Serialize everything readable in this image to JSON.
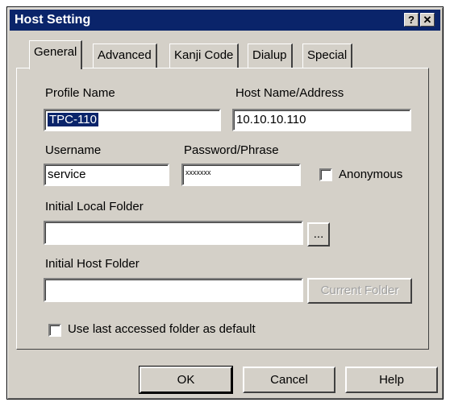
{
  "window": {
    "title": "Host Setting",
    "help_btn": "?",
    "close_btn": "✕"
  },
  "tabs": [
    {
      "label": "General",
      "active": true
    },
    {
      "label": "Advanced",
      "active": false
    },
    {
      "label": "Kanji Code",
      "active": false
    },
    {
      "label": "Dialup",
      "active": false
    },
    {
      "label": "Special",
      "active": false
    }
  ],
  "form": {
    "profile_name_label": "Profile Name",
    "profile_name_value": "TPC-110",
    "host_name_label": "Host Name/Address",
    "host_name_value": "10.10.10.110",
    "username_label": "Username",
    "username_value": "service",
    "password_label": "Password/Phrase",
    "password_value": "xxxxxxx",
    "anonymous_label": "Anonymous",
    "anonymous_checked": false,
    "local_folder_label": "Initial Local Folder",
    "local_folder_value": "",
    "browse_button": "...",
    "host_folder_label": "Initial Host Folder",
    "host_folder_value": "",
    "current_folder_button": "Current Folder",
    "use_last_label": "Use last accessed folder as default",
    "use_last_checked": false
  },
  "buttons": {
    "ok": "OK",
    "cancel": "Cancel",
    "help": "Help"
  }
}
